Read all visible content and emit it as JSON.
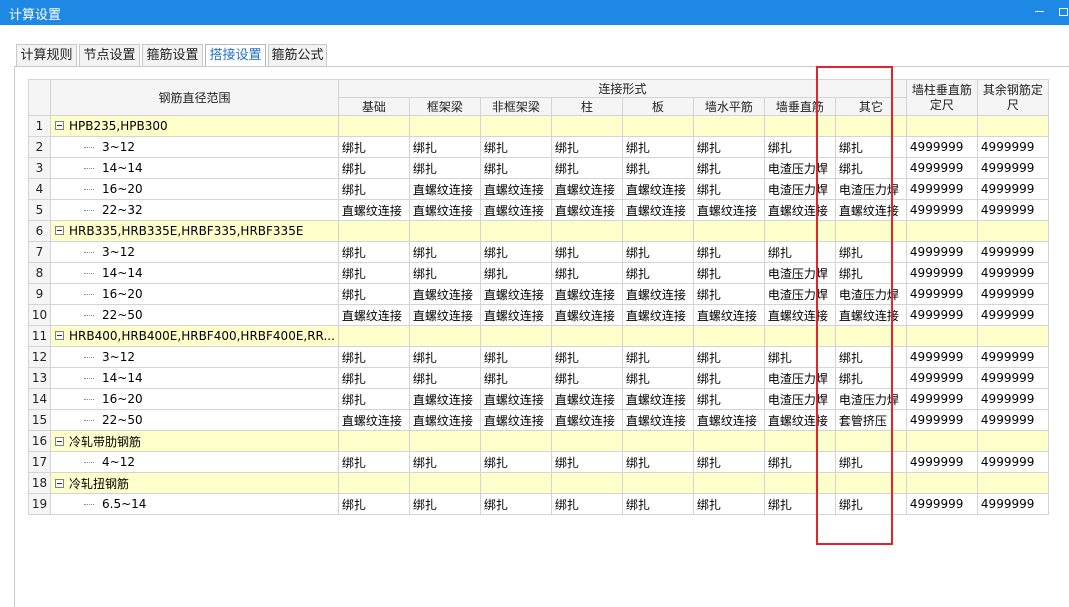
{
  "window": {
    "title": "计算设置"
  },
  "tabs": [
    {
      "label": "计算规则",
      "active": false
    },
    {
      "label": "节点设置",
      "active": false
    },
    {
      "label": "箍筋设置",
      "active": false
    },
    {
      "label": "搭接设置",
      "active": true
    },
    {
      "label": "箍筋公式",
      "active": false
    }
  ],
  "grid": {
    "header": {
      "range": "钢筋直径范围",
      "connection_group": "连接形式",
      "columns": [
        "基础",
        "框架梁",
        "非框架梁",
        "柱",
        "板",
        "墙水平筋",
        "墙垂直筋",
        "其它"
      ],
      "wall_col_fixed": "墙柱垂直筋定尺",
      "other_fixed": "其余钢筋定尺"
    },
    "rows": [
      {
        "num": "1",
        "group": true,
        "name": "HPB235,HPB300"
      },
      {
        "num": "2",
        "group": false,
        "name": "3~12",
        "cells": [
          "绑扎",
          "绑扎",
          "绑扎",
          "绑扎",
          "绑扎",
          "绑扎",
          "绑扎",
          "绑扎",
          "4999999",
          "4999999"
        ]
      },
      {
        "num": "3",
        "group": false,
        "name": "14~14",
        "cells": [
          "绑扎",
          "绑扎",
          "绑扎",
          "绑扎",
          "绑扎",
          "绑扎",
          "电渣压力焊",
          "绑扎",
          "4999999",
          "4999999"
        ]
      },
      {
        "num": "4",
        "group": false,
        "name": "16~20",
        "cells": [
          "绑扎",
          "直螺纹连接",
          "直螺纹连接",
          "直螺纹连接",
          "直螺纹连接",
          "绑扎",
          "电渣压力焊",
          "电渣压力焊",
          "4999999",
          "4999999"
        ]
      },
      {
        "num": "5",
        "group": false,
        "name": "22~32",
        "cells": [
          "直螺纹连接",
          "直螺纹连接",
          "直螺纹连接",
          "直螺纹连接",
          "直螺纹连接",
          "直螺纹连接",
          "直螺纹连接",
          "直螺纹连接",
          "4999999",
          "4999999"
        ]
      },
      {
        "num": "6",
        "group": true,
        "name": "HRB335,HRB335E,HRBF335,HRBF335E"
      },
      {
        "num": "7",
        "group": false,
        "name": "3~12",
        "cells": [
          "绑扎",
          "绑扎",
          "绑扎",
          "绑扎",
          "绑扎",
          "绑扎",
          "绑扎",
          "绑扎",
          "4999999",
          "4999999"
        ]
      },
      {
        "num": "8",
        "group": false,
        "name": "14~14",
        "cells": [
          "绑扎",
          "绑扎",
          "绑扎",
          "绑扎",
          "绑扎",
          "绑扎",
          "电渣压力焊",
          "绑扎",
          "4999999",
          "4999999"
        ]
      },
      {
        "num": "9",
        "group": false,
        "name": "16~20",
        "cells": [
          "绑扎",
          "直螺纹连接",
          "直螺纹连接",
          "直螺纹连接",
          "直螺纹连接",
          "绑扎",
          "电渣压力焊",
          "电渣压力焊",
          "4999999",
          "4999999"
        ]
      },
      {
        "num": "10",
        "group": false,
        "name": "22~50",
        "cells": [
          "直螺纹连接",
          "直螺纹连接",
          "直螺纹连接",
          "直螺纹连接",
          "直螺纹连接",
          "直螺纹连接",
          "直螺纹连接",
          "直螺纹连接",
          "4999999",
          "4999999"
        ]
      },
      {
        "num": "11",
        "group": true,
        "name": "HRB400,HRB400E,HRBF400,HRBF400E,RR..."
      },
      {
        "num": "12",
        "group": false,
        "name": "3~12",
        "cells": [
          "绑扎",
          "绑扎",
          "绑扎",
          "绑扎",
          "绑扎",
          "绑扎",
          "绑扎",
          "绑扎",
          "4999999",
          "4999999"
        ]
      },
      {
        "num": "13",
        "group": false,
        "name": "14~14",
        "cells": [
          "绑扎",
          "绑扎",
          "绑扎",
          "绑扎",
          "绑扎",
          "绑扎",
          "电渣压力焊",
          "绑扎",
          "4999999",
          "4999999"
        ]
      },
      {
        "num": "14",
        "group": false,
        "name": "16~20",
        "cells": [
          "绑扎",
          "直螺纹连接",
          "直螺纹连接",
          "直螺纹连接",
          "直螺纹连接",
          "绑扎",
          "电渣压力焊",
          "电渣压力焊",
          "4999999",
          "4999999"
        ]
      },
      {
        "num": "15",
        "group": false,
        "name": "22~50",
        "cells": [
          "直螺纹连接",
          "直螺纹连接",
          "直螺纹连接",
          "直螺纹连接",
          "直螺纹连接",
          "直螺纹连接",
          "直螺纹连接",
          "套管挤压",
          "4999999",
          "4999999"
        ]
      },
      {
        "num": "16",
        "group": true,
        "name": "冷轧带肋钢筋"
      },
      {
        "num": "17",
        "group": false,
        "name": "4~12",
        "cells": [
          "绑扎",
          "绑扎",
          "绑扎",
          "绑扎",
          "绑扎",
          "绑扎",
          "绑扎",
          "绑扎",
          "4999999",
          "4999999"
        ]
      },
      {
        "num": "18",
        "group": true,
        "name": "冷轧扭钢筋"
      },
      {
        "num": "19",
        "group": false,
        "name": "6.5~14",
        "cells": [
          "绑扎",
          "绑扎",
          "绑扎",
          "绑扎",
          "绑扎",
          "绑扎",
          "绑扎",
          "绑扎",
          "4999999",
          "4999999"
        ]
      }
    ]
  },
  "colors": {
    "titlebar": "#1e88e5",
    "group_row": "#ffffcc",
    "highlight_box": "#e0262a"
  }
}
